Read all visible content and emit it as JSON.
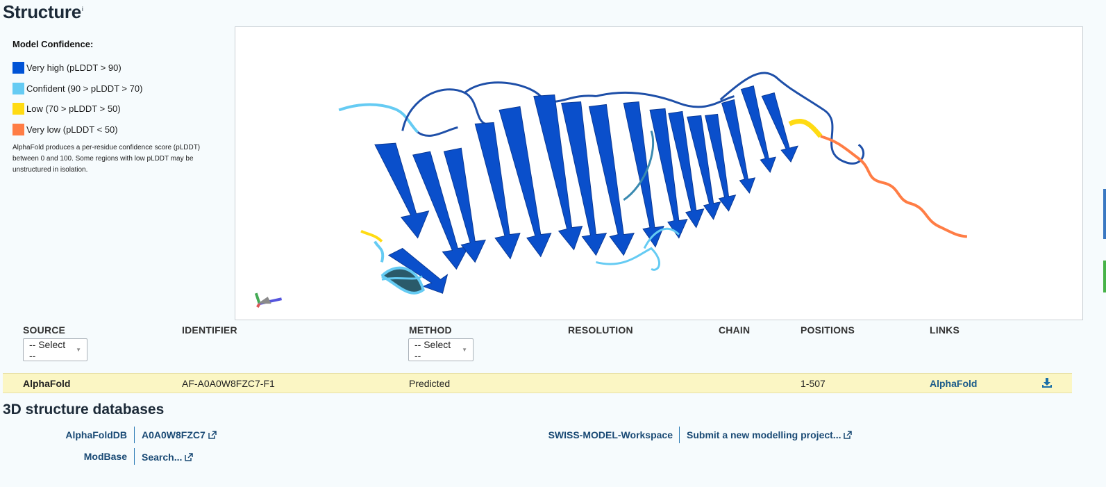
{
  "page": {
    "title": "Structure",
    "info_mark": "i"
  },
  "legend": {
    "heading": "Model Confidence:",
    "items": [
      {
        "label": "Very high (pLDDT > 90)",
        "color": "#0053d6"
      },
      {
        "label": "Confident (90 > pLDDT > 70)",
        "color": "#65cbf3"
      },
      {
        "label": "Low (70 > pLDDT > 50)",
        "color": "#ffdb13"
      },
      {
        "label": "Very low (pLDDT < 50)",
        "color": "#ff7d45"
      }
    ],
    "note": "AlphaFold produces a per-residue confidence score (pLDDT) between 0 and 100. Some regions with low pLDDT may be unstructured in isolation."
  },
  "viewer": {
    "icon": "protein-3d-model",
    "axes_icon": "orientation-axes"
  },
  "table": {
    "columns": [
      "SOURCE",
      "IDENTIFIER",
      "METHOD",
      "RESOLUTION",
      "CHAIN",
      "POSITIONS",
      "LINKS"
    ],
    "source_select": "-- Select --",
    "method_select": "-- Select --",
    "rows": [
      {
        "source": "AlphaFold",
        "identifier": "AF-A0A0W8FZC7-F1",
        "method": "Predicted",
        "resolution": "",
        "chain": "",
        "positions": "1-507",
        "link": "AlphaFold",
        "download_icon": "download-icon"
      }
    ],
    "highlight_color": "#fbf6c4"
  },
  "databases": {
    "title": "3D structure databases",
    "entries": [
      {
        "name": "AlphaFoldDB",
        "value": "A0A0W8FZC7"
      },
      {
        "name": "ModBase",
        "value": "Search..."
      },
      {
        "name": "SWISS-MODEL-Workspace",
        "value": "Submit a new modelling project..."
      }
    ],
    "link_color": "#1a4a75"
  }
}
